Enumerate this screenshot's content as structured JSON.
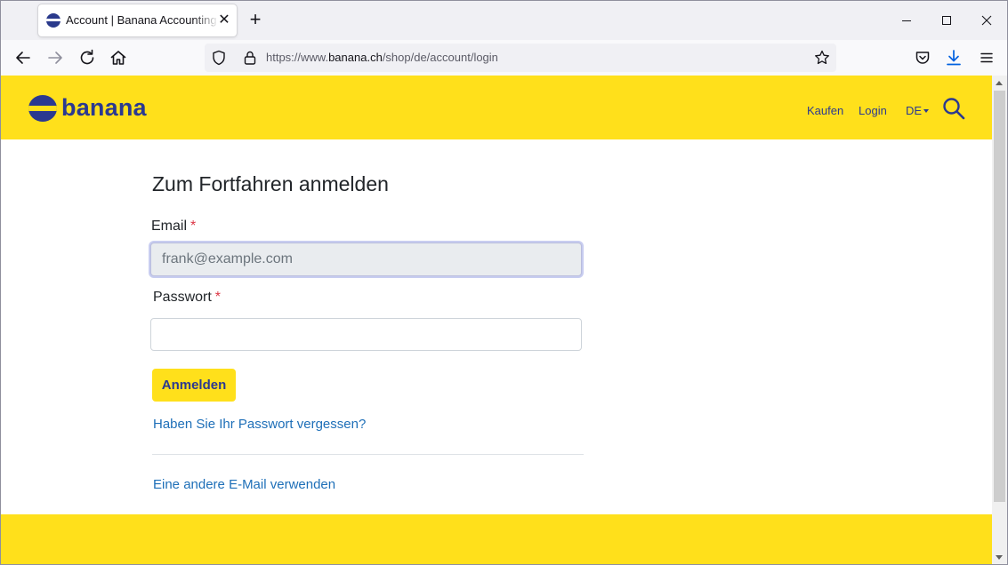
{
  "browser": {
    "tab_title": "Account | Banana Accounting S",
    "tab_close": "✕",
    "new_tab": "+",
    "url_prefix": "https://www.",
    "url_host": "banana.ch",
    "url_path": "/shop/de/account/login"
  },
  "header": {
    "logo_text": "banana",
    "nav_buy": "Kaufen",
    "nav_login": "Login",
    "lang": "DE"
  },
  "login": {
    "title": "Zum Fortfahren anmelden",
    "email_label": "Email",
    "email_value": "frank@example.com",
    "password_label": "Passwort",
    "required_mark": "*",
    "submit": "Anmelden",
    "forgot_link": "Haben Sie Ihr Passwort vergessen?",
    "other_email_link": "Eine andere E-Mail verwenden"
  },
  "colors": {
    "brand_yellow": "#ffe01b",
    "brand_blue": "#2b3990",
    "link_blue": "#1e6fb8"
  }
}
